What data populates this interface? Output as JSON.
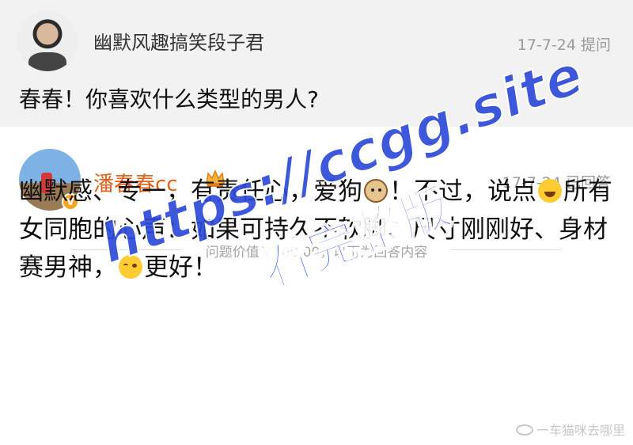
{
  "question": {
    "user_name": "幽默风趣搞笑段子君",
    "date": "17-7-24",
    "action": "提问",
    "text": "春春！你喜欢什么类型的男人?"
  },
  "answer": {
    "user_name": "潘春春cc",
    "date": "17-7-24",
    "status": "已回答",
    "verified_badge": "V",
    "divider_label": "问题价值￥100.00，以下为回答内容",
    "text_part1": "幽默感、专一，有责任心，爱狗",
    "text_part2": "！不过，说点",
    "text_part3": "所有女同胞的心声：如果可持久不软脚、尺寸刚刚好、身材赛男神，",
    "text_part4": "更好！",
    "emoji_icons": [
      "dog-face-icon",
      "sweat-smile-icon",
      "relieved-face-icon"
    ]
  },
  "watermark": {
    "url": "https://ccgg.site",
    "cta": "看完整版"
  },
  "credit": {
    "text": "一车猫咪去哪里"
  },
  "colors": {
    "question_bg": "#f2f2f2",
    "answerer_name": "#e2621b",
    "watermark": "#2d4ad8",
    "meta_gray": "#9a9a9a"
  }
}
